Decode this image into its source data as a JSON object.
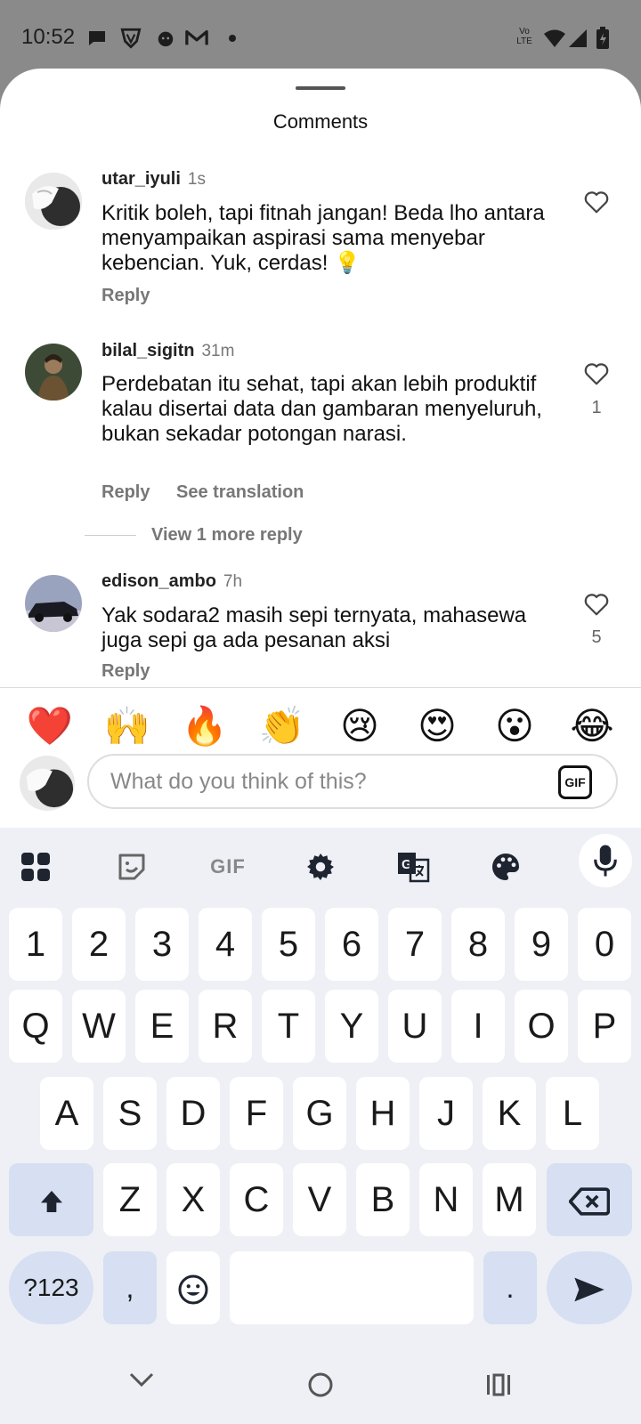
{
  "status_bar": {
    "time": "10:52",
    "icons": [
      "chat-bubble-icon",
      "shield-icon",
      "reddit-icon",
      "gmail-icon",
      "dot-icon",
      "volte-icon",
      "wifi-icon",
      "signal-icon",
      "battery-icon"
    ],
    "volte_label": "Vo LTE"
  },
  "sheet": {
    "title": "Comments"
  },
  "comments": [
    {
      "username": "utar_iyuli",
      "time": "1s",
      "text": "Kritik boleh, tapi fitnah jangan! Beda lho antara menyampaikan aspirasi sama menyebar kebencian. Yuk, cerdas! 💡",
      "reply": "Reply",
      "likes": ""
    },
    {
      "username": "bilal_sigitn",
      "time": "31m",
      "text": "Perdebatan itu sehat, tapi akan lebih produktif kalau disertai data dan gambaran menyeluruh, bukan sekadar potongan narasi.",
      "reply": "Reply",
      "see_translation": "See translation",
      "likes": "1",
      "view_more": "View 1 more reply"
    },
    {
      "username": "edison_ambo",
      "time": "7h",
      "text": "Yak sodara2 masih sepi ternyata, mahasewa juga sepi ga ada pesanan aksi",
      "reply": "Reply",
      "likes": "5"
    }
  ],
  "emoji_bar": [
    "❤️",
    "🙌",
    "🔥",
    "👏",
    "😢",
    "😍",
    "😮",
    "😂"
  ],
  "input": {
    "placeholder": "What do you think of this?",
    "gif": "GIF"
  },
  "keyboard": {
    "tools": [
      "apps-grid-icon",
      "sticker-icon",
      "gif-icon",
      "settings-icon",
      "translate-icon",
      "palette-icon",
      "mic-icon"
    ],
    "gif_label": "GIF",
    "row_numbers": [
      "1",
      "2",
      "3",
      "4",
      "5",
      "6",
      "7",
      "8",
      "9",
      "0"
    ],
    "row1": [
      "Q",
      "W",
      "E",
      "R",
      "T",
      "Y",
      "U",
      "I",
      "O",
      "P"
    ],
    "row2": [
      "A",
      "S",
      "D",
      "F",
      "G",
      "H",
      "J",
      "K",
      "L"
    ],
    "row3": [
      "Z",
      "X",
      "C",
      "V",
      "B",
      "N",
      "M"
    ],
    "symbols_label": "?123",
    "comma": ",",
    "period": "."
  },
  "colors": {
    "sheet_bg": "#ffffff",
    "keyboard_bg": "#eef0f5",
    "alt_key": "#d6e0f2",
    "heart_red": "#e0292c"
  }
}
